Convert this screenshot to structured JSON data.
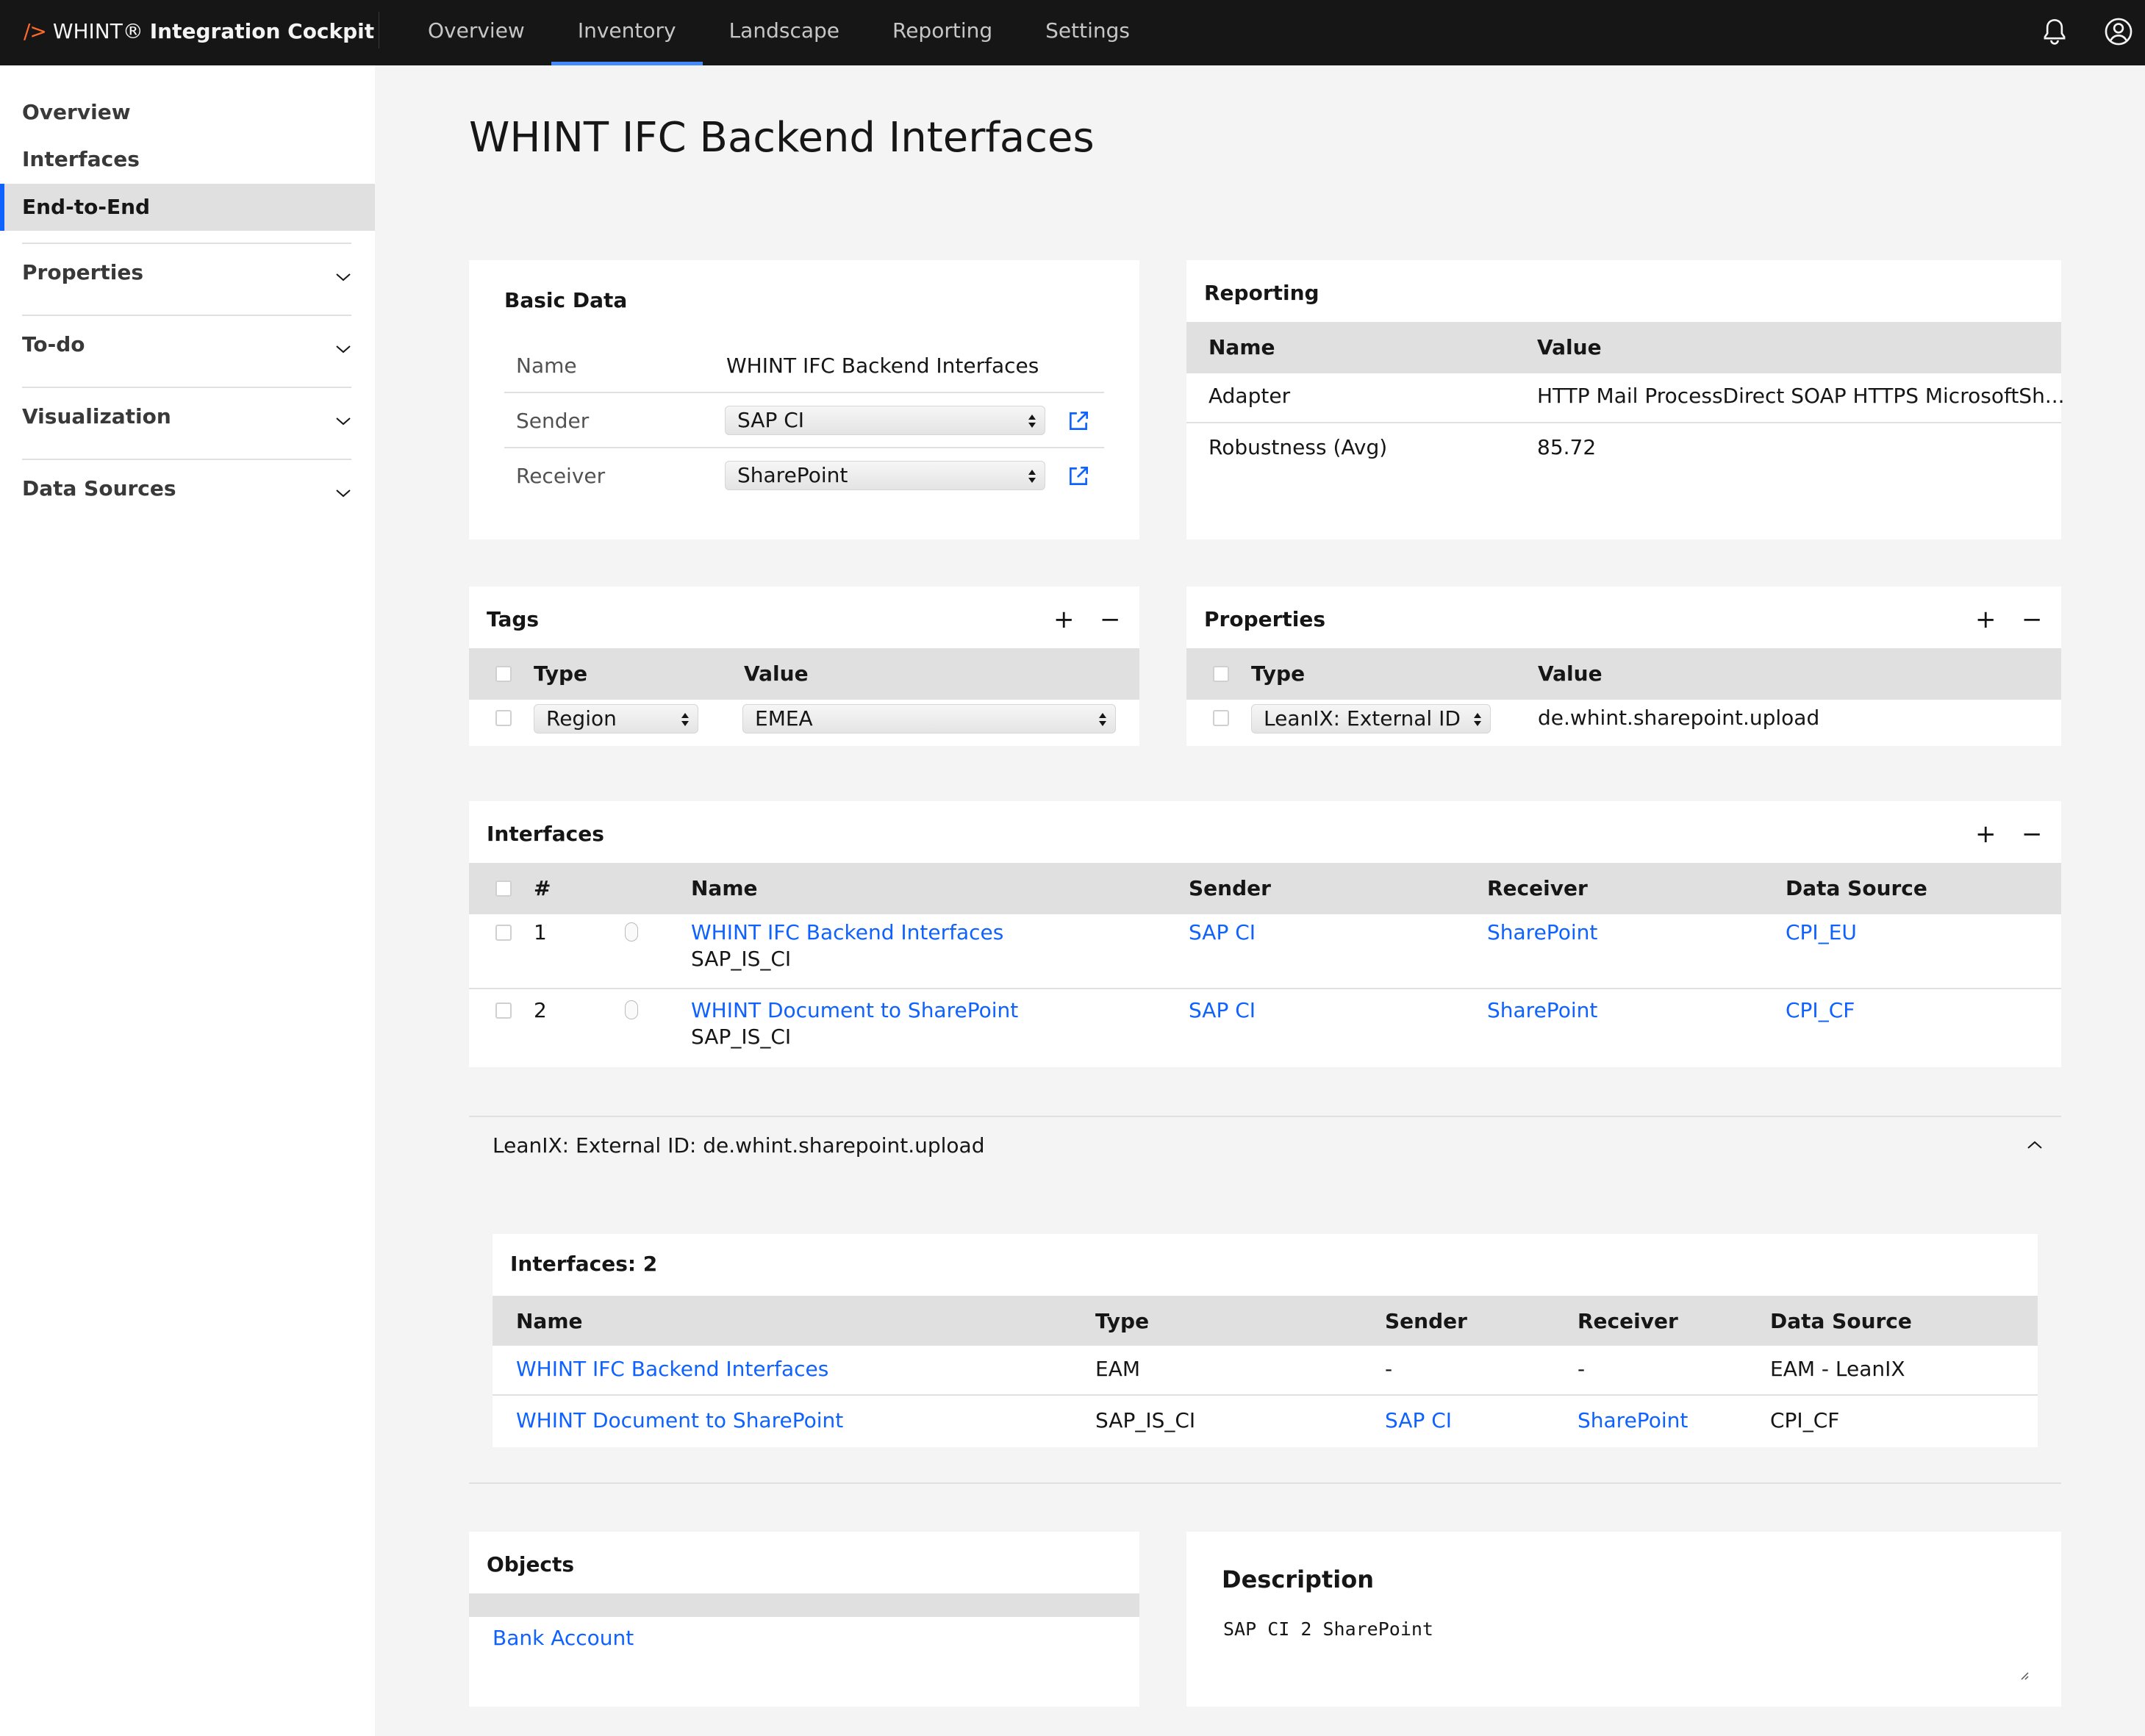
{
  "app": {
    "brand_prefix": "/>",
    "brand_name": "WHINT®",
    "brand_product": "Integration Cockpit",
    "accent_color": "#0f62fe",
    "brand_color": "#ff6a2b"
  },
  "top_nav": {
    "tabs": [
      {
        "label": "Overview",
        "active": false
      },
      {
        "label": "Inventory",
        "active": true
      },
      {
        "label": "Landscape",
        "active": false
      },
      {
        "label": "Reporting",
        "active": false
      },
      {
        "label": "Settings",
        "active": false
      }
    ],
    "icons": [
      "bell-icon",
      "user-avatar-icon"
    ]
  },
  "sidebar": {
    "items": [
      {
        "label": "Overview",
        "active": false
      },
      {
        "label": "Interfaces",
        "active": false
      },
      {
        "label": "End-to-End",
        "active": true
      }
    ],
    "groups": [
      {
        "label": "Properties"
      },
      {
        "label": "To-do"
      },
      {
        "label": "Visualization"
      },
      {
        "label": "Data Sources"
      }
    ]
  },
  "page": {
    "title": "WHINT IFC Backend Interfaces"
  },
  "basic_data": {
    "heading": "Basic Data",
    "name_label": "Name",
    "name_value": "WHINT IFC Backend Interfaces",
    "sender_label": "Sender",
    "sender_value": "SAP CI",
    "receiver_label": "Receiver",
    "receiver_value": "SharePoint"
  },
  "reporting": {
    "heading": "Reporting",
    "col_name": "Name",
    "col_value": "Value",
    "rows": [
      {
        "name": "Adapter",
        "value": "HTTP Mail ProcessDirect SOAP HTTPS MicrosoftSh..."
      },
      {
        "name": "Robustness (Avg)",
        "value": "85.72"
      }
    ]
  },
  "tags": {
    "heading": "Tags",
    "add": "+",
    "remove": "−",
    "col_type": "Type",
    "col_value": "Value",
    "rows": [
      {
        "type": "Region",
        "value": "EMEA"
      }
    ]
  },
  "properties": {
    "heading": "Properties",
    "add": "+",
    "remove": "−",
    "col_type": "Type",
    "col_value": "Value",
    "rows": [
      {
        "type": "LeanIX: External ID",
        "value": "de.whint.sharepoint.upload"
      }
    ]
  },
  "interfaces": {
    "heading": "Interfaces",
    "add": "+",
    "remove": "−",
    "col_num": "#",
    "col_name": "Name",
    "col_sender": "Sender",
    "col_receiver": "Receiver",
    "col_source": "Data Source",
    "rows": [
      {
        "num": "1",
        "name": "WHINT IFC Backend Interfaces",
        "type": "SAP_IS_CI",
        "sender": "SAP CI",
        "receiver": "SharePoint",
        "source": "CPI_EU"
      },
      {
        "num": "2",
        "name": "WHINT Document to SharePoint",
        "type": "SAP_IS_CI",
        "sender": "SAP CI",
        "receiver": "SharePoint",
        "source": "CPI_CF"
      }
    ]
  },
  "accordion": {
    "title": "LeanIX: External ID: de.whint.sharepoint.upload",
    "expanded": true,
    "count_label": "Interfaces: 2",
    "col_name": "Name",
    "col_type": "Type",
    "col_sender": "Sender",
    "col_receiver": "Receiver",
    "col_source": "Data Source",
    "rows": [
      {
        "name": "WHINT IFC Backend Interfaces",
        "type": "EAM",
        "sender": "-",
        "receiver": "-",
        "source": "EAM - LeanIX"
      },
      {
        "name": "WHINT Document to SharePoint",
        "type": "SAP_IS_CI",
        "sender": "SAP CI",
        "receiver": "SharePoint",
        "source": "CPI_CF"
      }
    ]
  },
  "objects": {
    "heading": "Objects",
    "items": [
      "Bank Account"
    ]
  },
  "description": {
    "heading": "Description",
    "value": "SAP CI 2 SharePoint"
  }
}
